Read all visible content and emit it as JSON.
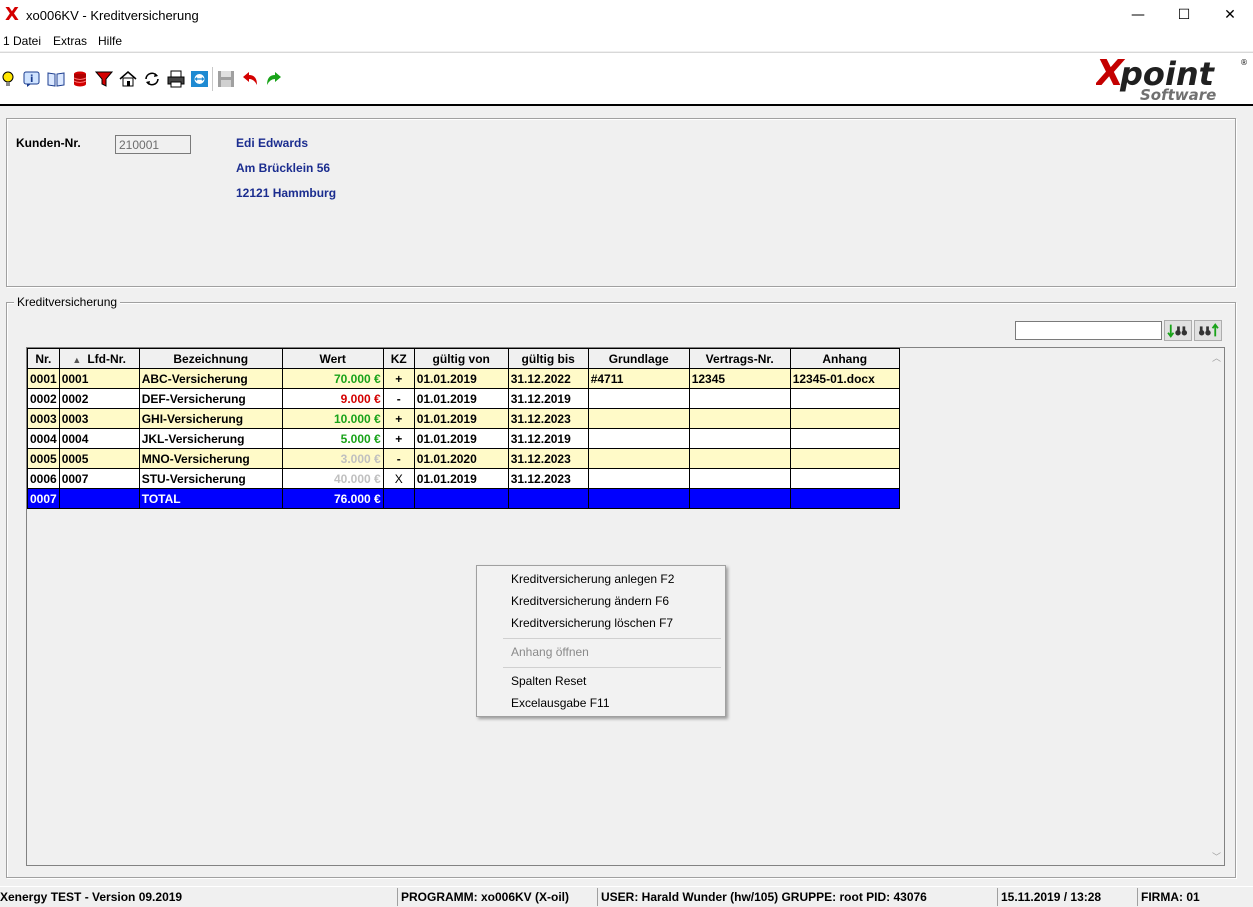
{
  "window": {
    "title": "xo006KV - Kreditversicherung",
    "minimize": "—",
    "maximize": "☐",
    "close": "✕"
  },
  "menu": [
    "1 Datei",
    "Extras",
    "Hilfe"
  ],
  "toolbar": {
    "icons": [
      "lightbulb-icon",
      "info-icon",
      "book-icon",
      "database-icon",
      "filter-icon",
      "home-icon",
      "refresh-icon",
      "print-icon",
      "link-icon",
      "save-icon",
      "undo-icon",
      "redo-icon"
    ]
  },
  "logo": {
    "text_top": "Xpoint",
    "text_bottom": "Software",
    "reg": "®"
  },
  "kunde": {
    "label": "Kunden-Nr.",
    "nr": "210001",
    "name": "Edi Edwards",
    "street": "Am Brücklein 56",
    "city": "12121 Hammburg"
  },
  "kv": {
    "legend": "Kreditversicherung",
    "columns": [
      "Nr.",
      "Lfd-Nr.",
      "Bezeichnung",
      "Wert",
      "KZ",
      "gültig von",
      "gültig bis",
      "Grundlage",
      "Vertrags-Nr.",
      "Anhang"
    ],
    "rows": [
      {
        "nr": "0001",
        "lfd": "0001",
        "bez": "ABC-Versicherung",
        "wert": "70.000 €",
        "kz": "+",
        "von": "01.01.2019",
        "bis": "31.12.2022",
        "grund": "#4711",
        "vertrag": "12345",
        "anhang": "12345-01.docx",
        "style": "yellow",
        "wert_color": "#19a319"
      },
      {
        "nr": "0002",
        "lfd": "0002",
        "bez": "DEF-Versicherung",
        "wert": "9.000 €",
        "kz": "-",
        "von": "01.01.2019",
        "bis": "31.12.2019",
        "grund": "",
        "vertrag": "",
        "anhang": "",
        "style": "white",
        "wert_color": "#d40000"
      },
      {
        "nr": "0003",
        "lfd": "0003",
        "bez": "GHI-Versicherung",
        "wert": "10.000 €",
        "kz": "+",
        "von": "01.01.2019",
        "bis": "31.12.2023",
        "grund": "",
        "vertrag": "",
        "anhang": "",
        "style": "yellow",
        "wert_color": "#19a319"
      },
      {
        "nr": "0004",
        "lfd": "0004",
        "bez": "JKL-Versicherung",
        "wert": "5.000 €",
        "kz": "+",
        "von": "01.01.2019",
        "bis": "31.12.2019",
        "grund": "",
        "vertrag": "",
        "anhang": "",
        "style": "white",
        "wert_color": "#19a319"
      },
      {
        "nr": "0005",
        "lfd": "0005",
        "bez": "MNO-Versicherung",
        "wert": "3.000 €",
        "kz": "-",
        "von": "01.01.2020",
        "bis": "31.12.2023",
        "grund": "",
        "vertrag": "",
        "anhang": "",
        "style": "yellow",
        "wert_color": "#c0c0c0"
      },
      {
        "nr": "0006",
        "lfd": "0007",
        "bez": "STU-Versicherung",
        "wert": "40.000 €",
        "kz": "X",
        "von": "01.01.2019",
        "bis": "31.12.2023",
        "grund": "",
        "vertrag": "",
        "anhang": "",
        "style": "white",
        "wert_color": "#c0c0c0"
      },
      {
        "nr": "0007",
        "lfd": "",
        "bez": "TOTAL",
        "wert": "76.000 €",
        "kz": "",
        "von": "",
        "bis": "",
        "grund": "",
        "vertrag": "",
        "anhang": "",
        "style": "total",
        "wert_color": "#ffffff"
      }
    ]
  },
  "context_menu": {
    "items": [
      "Kreditversicherung anlegen F2",
      "Kreditversicherung ändern F6",
      "Kreditversicherung löschen F7",
      "Anhang öffnen",
      "Spalten Reset",
      "Excelausgabe F11"
    ]
  },
  "status": {
    "version": "Xenergy TEST - Version 09.2019",
    "programm": "PROGRAMM: xo006KV (X-oil)",
    "user": "USER: Harald Wunder (hw/105)  GRUPPE: root  PID: 43076",
    "datetime": "15.11.2019 / 13:28",
    "firma": "FIRMA: 01"
  }
}
